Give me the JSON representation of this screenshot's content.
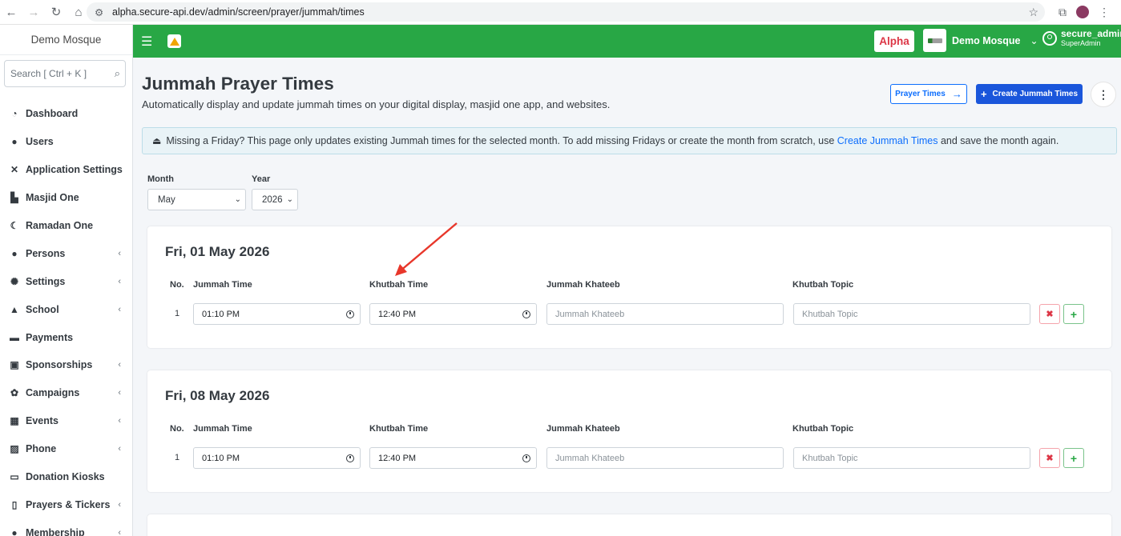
{
  "browser": {
    "url": "alpha.secure-api.dev/admin/screen/prayer/jummah/times"
  },
  "sidebar": {
    "brand": "Demo Mosque",
    "search_placeholder": "Search [ Ctrl + K ]",
    "items": [
      {
        "label": "Dashboard",
        "icon": "dashboard-icon",
        "glyph": "◔",
        "submenu": false
      },
      {
        "label": "Users",
        "icon": "user-icon",
        "glyph": "●",
        "submenu": false
      },
      {
        "label": "Application Settings",
        "icon": "tools-icon",
        "glyph": "✕",
        "submenu": false
      },
      {
        "label": "Masjid One",
        "icon": "mosque-icon",
        "glyph": "▙",
        "submenu": false
      },
      {
        "label": "Ramadan One",
        "icon": "moon-icon",
        "glyph": "☾",
        "submenu": false
      },
      {
        "label": "Persons",
        "icon": "users-icon",
        "glyph": "●",
        "submenu": true
      },
      {
        "label": "Settings",
        "icon": "gear-icon",
        "glyph": "✺",
        "submenu": true
      },
      {
        "label": "School",
        "icon": "graduation-cap-icon",
        "glyph": "▲",
        "submenu": true
      },
      {
        "label": "Payments",
        "icon": "money-icon",
        "glyph": "▬",
        "submenu": false
      },
      {
        "label": "Sponsorships",
        "icon": "sponsorship-icon",
        "glyph": "▣",
        "submenu": true
      },
      {
        "label": "Campaigns",
        "icon": "campaign-icon",
        "glyph": "✿",
        "submenu": true
      },
      {
        "label": "Events",
        "icon": "calendar-icon",
        "glyph": "▦",
        "submenu": true
      },
      {
        "label": "Phone",
        "icon": "phone-icon",
        "glyph": "▨",
        "submenu": true
      },
      {
        "label": "Donation Kiosks",
        "icon": "monitor-icon",
        "glyph": "▭",
        "submenu": false
      },
      {
        "label": "Prayers & Tickers",
        "icon": "mobile-icon",
        "glyph": "▯",
        "submenu": true
      },
      {
        "label": "Membership",
        "icon": "membership-icon",
        "glyph": "●",
        "submenu": true
      }
    ]
  },
  "topbar": {
    "env_badge": "Alpha",
    "mosque_name": "Demo Mosque",
    "user_name": "secure_admin",
    "user_role": "SuperAdmin"
  },
  "header": {
    "title": "Jummah Prayer Times",
    "subtitle": "Automatically display and update jummah times on your digital display, masjid one app, and websites.",
    "prayer_times_button": "Prayer Times",
    "create_button": "Create Jummah Times"
  },
  "alert": {
    "text_before": "Missing a Friday? This page only updates existing Jummah times for the selected month. To add missing Fridays or create the month from scratch, use ",
    "link": "Create Jummah Times",
    "text_after": " and save the month again."
  },
  "filters": {
    "month_label": "Month",
    "month_value": "May",
    "year_label": "Year",
    "year_value": "2026"
  },
  "columns": {
    "no": "No.",
    "jummah_time": "Jummah Time",
    "khutbah_time": "Khutbah Time",
    "khateeb": "Jummah Khateeb",
    "topic": "Khutbah Topic"
  },
  "fridays": [
    {
      "date": "Fri, 01 May 2026",
      "rows": [
        {
          "no": "1",
          "jummah_time": "01:10 PM",
          "khutbah_time": "12:40 PM",
          "khateeb_placeholder": "Jummah Khateeb",
          "topic_placeholder": "Khutbah Topic"
        }
      ]
    },
    {
      "date": "Fri, 08 May 2026",
      "rows": [
        {
          "no": "1",
          "jummah_time": "01:10 PM",
          "khutbah_time": "12:40 PM",
          "khateeb_placeholder": "Jummah Khateeb",
          "topic_placeholder": "Khutbah Topic"
        }
      ]
    }
  ],
  "colors": {
    "topbar": "#28a745",
    "primary": "#1a56db",
    "danger": "#dc3545",
    "annotation_arrow": "#e8372b"
  }
}
